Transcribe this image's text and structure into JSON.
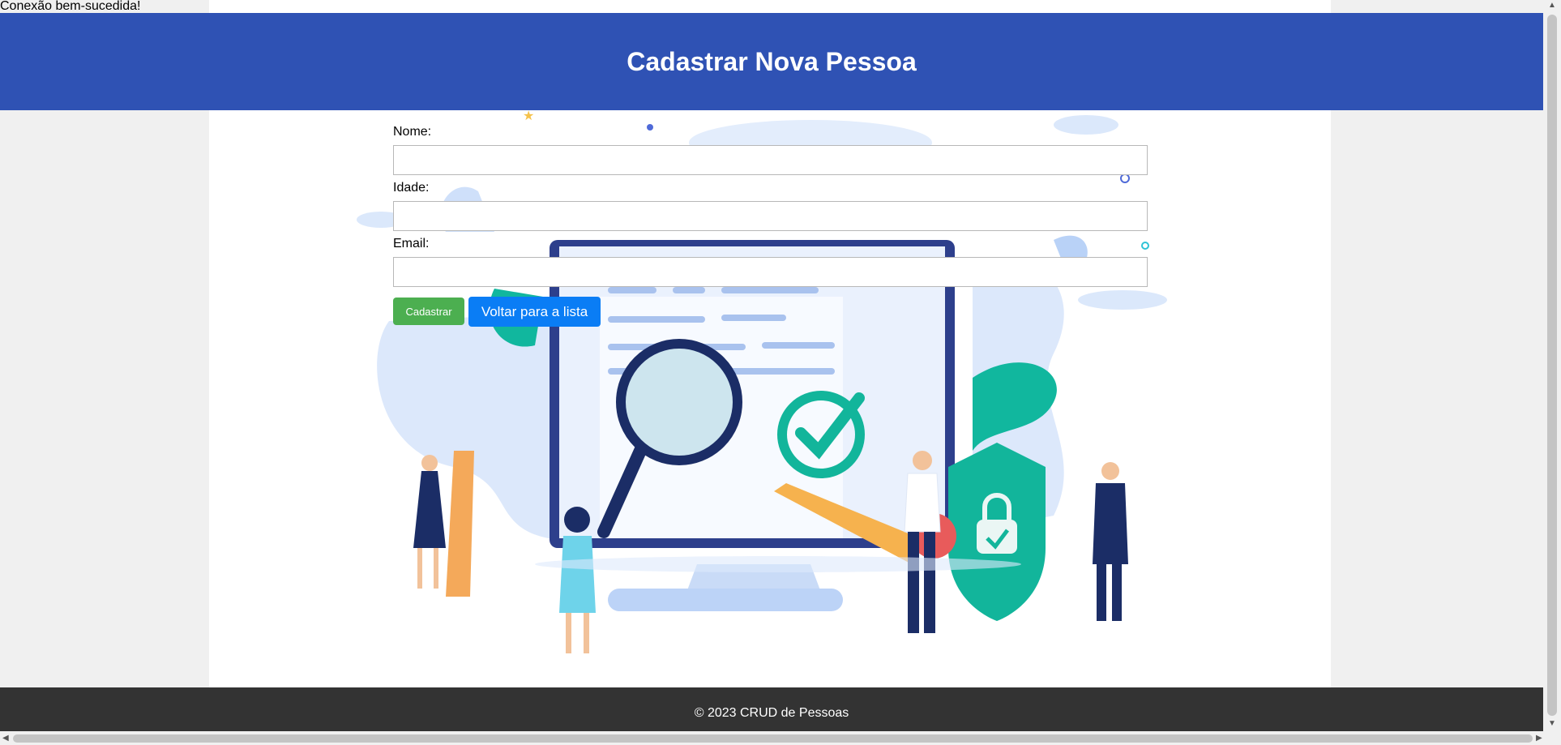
{
  "status": {
    "message": "Conexão bem-sucedida!"
  },
  "header": {
    "title": "Cadastrar Nova Pessoa"
  },
  "form": {
    "name_label": "Nome:",
    "name_value": "",
    "age_label": "Idade:",
    "age_value": "",
    "email_label": "Email:",
    "email_value": "",
    "submit_label": "Cadastrar",
    "back_label": "Voltar para a lista"
  },
  "footer": {
    "text": "© 2023 CRUD de Pessoas"
  },
  "colors": {
    "header_bg": "#2f52b4",
    "submit_bg": "#4caf50",
    "back_bg": "#0a7df5",
    "footer_bg": "#333333"
  }
}
